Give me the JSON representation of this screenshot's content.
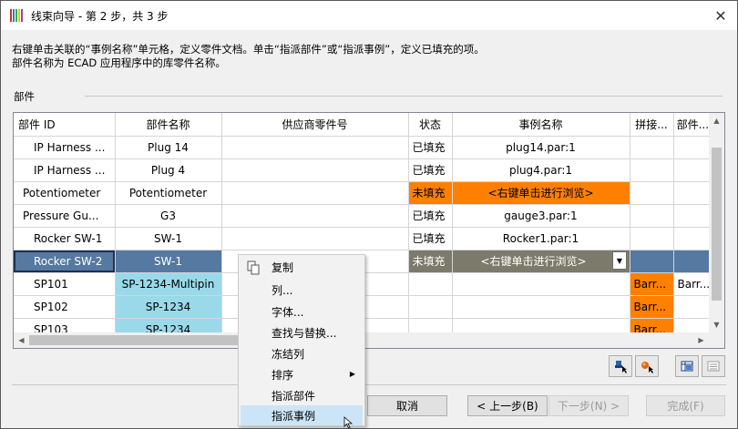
{
  "window": {
    "title": "线束向导 - 第 2 步，共 3 步",
    "close_glyph": "✕"
  },
  "instructions": {
    "line1": "右键单击关联的“事例名称”单元格，定义零件文档。单击“指派部件”或“指派事例”，定义已填充的项。",
    "line2": "部件名称为 ECAD 应用程序中的库零件名称。"
  },
  "group": {
    "label": "部件"
  },
  "grid": {
    "columns": [
      "部件 ID",
      "部件名称",
      "供应商零件号",
      "状态",
      "事例名称",
      "拼接...",
      "部件..."
    ],
    "rows": [
      {
        "id": "IP Harness ...",
        "name": "Plug 14",
        "vendor": "",
        "status": "已填充",
        "instance": "plug14.par:1",
        "splice": "",
        "part": "",
        "highlight": "none"
      },
      {
        "id": "IP Harness ...",
        "name": "Plug 4",
        "vendor": "",
        "status": "已填充",
        "instance": "plug4.par:1",
        "splice": "",
        "part": "",
        "highlight": "none"
      },
      {
        "id": "Potentiometer",
        "name": "Potentiometer",
        "vendor": "",
        "status": "未填充",
        "instance": "<右键单击进行浏览>",
        "splice": "",
        "part": "",
        "highlight": "orange"
      },
      {
        "id": "Pressure Gu...",
        "name": "G3",
        "vendor": "",
        "status": "已填充",
        "instance": "gauge3.par:1",
        "splice": "",
        "part": "",
        "highlight": "none"
      },
      {
        "id": "Rocker SW-1",
        "name": "SW-1",
        "vendor": "",
        "status": "已填充",
        "instance": "Rocker1.par:1",
        "splice": "",
        "part": "",
        "highlight": "none"
      },
      {
        "id": "Rocker SW-2",
        "name": "SW-1",
        "vendor": "",
        "status": "未填充",
        "instance": "<右键单击进行浏览>",
        "splice": "",
        "part": "",
        "highlight": "selected"
      },
      {
        "id": "SP101",
        "name": "SP-1234-Multipin",
        "vendor": "",
        "status": "",
        "instance": "",
        "splice": "Barr...",
        "part": "Barr...",
        "highlight": "cyan"
      },
      {
        "id": "SP102",
        "name": "SP-1234",
        "vendor": "",
        "status": "",
        "instance": "",
        "splice": "Barr...",
        "part": "",
        "highlight": "cyan"
      },
      {
        "id": "SP103",
        "name": "SP-1234",
        "vendor": "",
        "status": "",
        "instance": "",
        "splice": "Barr...",
        "part": "",
        "highlight": "cyan"
      }
    ]
  },
  "context_menu": {
    "items": [
      "复制",
      "列...",
      "字体...",
      "查找与替换...",
      "冻结列",
      "排序",
      "指派部件",
      "指派事例"
    ],
    "highlighted": "指派事例",
    "submenu_item": "排序"
  },
  "toolbar_icons": [
    "assign-part-icon",
    "assign-instance-icon",
    "grid-view-icon",
    "list-view-icon"
  ],
  "buttons": {
    "cancel": "取消",
    "back": "< 上一步(B)",
    "next": "下一步(N) >",
    "finish": "完成(F)"
  },
  "colors": {
    "unfilled_highlight": "#ff8000",
    "splice_highlight": "#9ad9ea",
    "selection": "#5579a0"
  }
}
